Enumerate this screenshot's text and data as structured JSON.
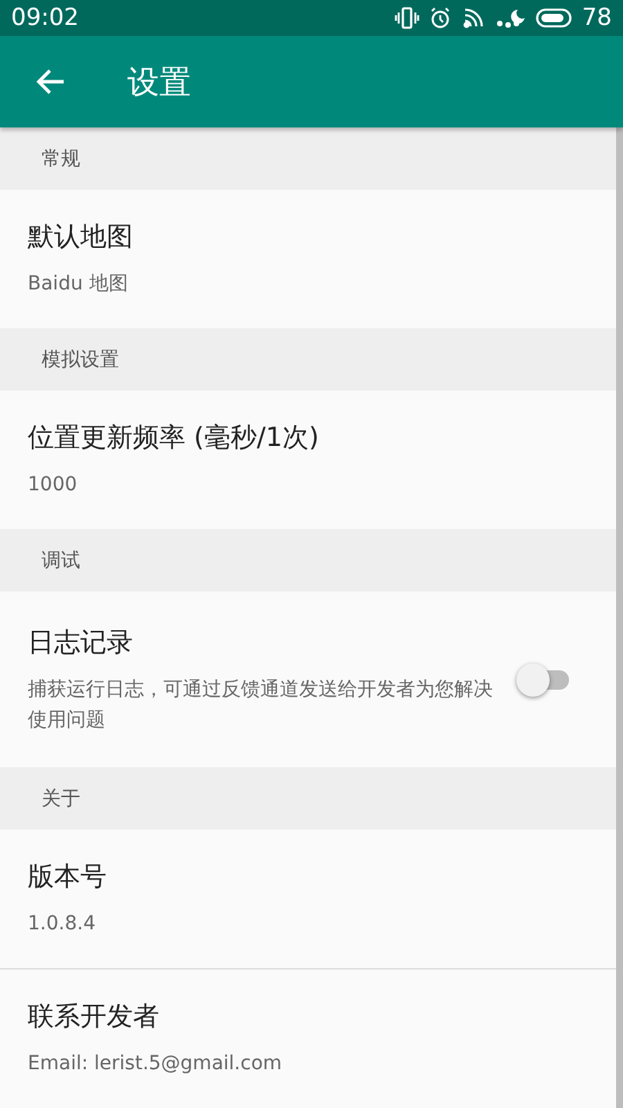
{
  "status_bar": {
    "time": "09:02",
    "battery": "78"
  },
  "toolbar": {
    "title": "设置"
  },
  "sections": [
    {
      "header": "常规",
      "items": [
        {
          "kind": "text",
          "title": "默认地图",
          "summary": "Baidu 地图"
        }
      ]
    },
    {
      "header": "模拟设置",
      "items": [
        {
          "kind": "text",
          "title": "位置更新频率 (毫秒/1次)",
          "summary": "1000"
        }
      ]
    },
    {
      "header": "调试",
      "items": [
        {
          "kind": "switch",
          "title": "日志记录",
          "summary": "捕获运行日志，可通过反馈通道发送给开发者为您解决使用问题",
          "on": false
        }
      ]
    },
    {
      "header": "关于",
      "items": [
        {
          "kind": "text",
          "title": "版本号",
          "summary": "1.0.8.4"
        },
        {
          "kind": "text",
          "title": "联系开发者",
          "summary": "Email: lerist.5@gmail.com"
        }
      ]
    }
  ]
}
